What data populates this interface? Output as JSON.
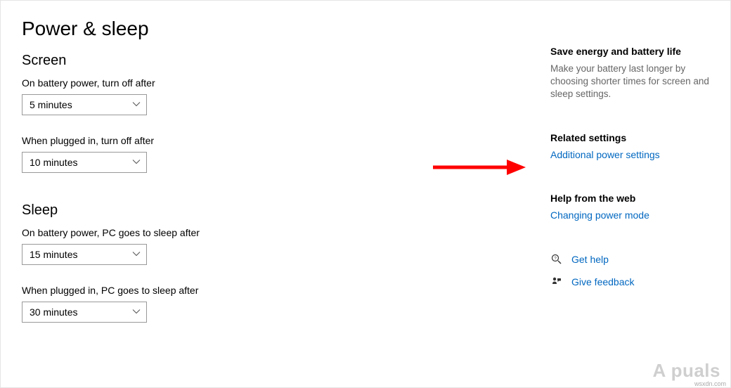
{
  "page": {
    "title": "Power & sleep"
  },
  "sections": {
    "screen": {
      "title": "Screen",
      "battery_label": "On battery power, turn off after",
      "battery_value": "5 minutes",
      "plugged_label": "When plugged in, turn off after",
      "plugged_value": "10 minutes"
    },
    "sleep": {
      "title": "Sleep",
      "battery_label": "On battery power, PC goes to sleep after",
      "battery_value": "15 minutes",
      "plugged_label": "When plugged in, PC goes to sleep after",
      "plugged_value": "30 minutes"
    }
  },
  "sidebar": {
    "save_energy": {
      "heading": "Save energy and battery life",
      "text": "Make your battery last longer by choosing shorter times for screen and sleep settings."
    },
    "related": {
      "heading": "Related settings",
      "link": "Additional power settings"
    },
    "help_web": {
      "heading": "Help from the web",
      "link": "Changing power mode"
    },
    "get_help": "Get help",
    "give_feedback": "Give feedback"
  },
  "watermark": "A  puals",
  "attribution": "wsxdn.com"
}
